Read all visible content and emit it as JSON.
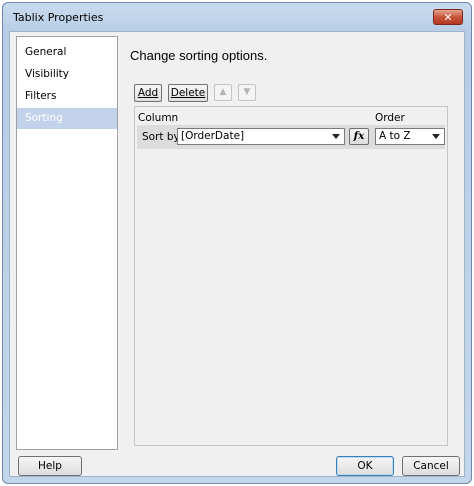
{
  "window": {
    "title": "Tablix Properties",
    "close_glyph": "✕"
  },
  "nav": {
    "items": [
      {
        "label": "General",
        "selected": false
      },
      {
        "label": "Visibility",
        "selected": false
      },
      {
        "label": "Filters",
        "selected": false
      },
      {
        "label": "Sorting",
        "selected": true
      }
    ]
  },
  "main": {
    "heading": "Change sorting options."
  },
  "toolbar": {
    "add_label": "Add",
    "delete_label": "Delete",
    "move_up_icon": "up-arrow-icon",
    "move_down_icon": "down-arrow-icon"
  },
  "grid": {
    "column_header": "Column",
    "order_header": "Order",
    "rows": [
      {
        "label": "Sort by",
        "column_value": "[OrderDate]",
        "fx_label": "fx",
        "order_value": "A to Z"
      }
    ]
  },
  "footer": {
    "help_label": "Help",
    "ok_label": "OK",
    "cancel_label": "Cancel"
  }
}
